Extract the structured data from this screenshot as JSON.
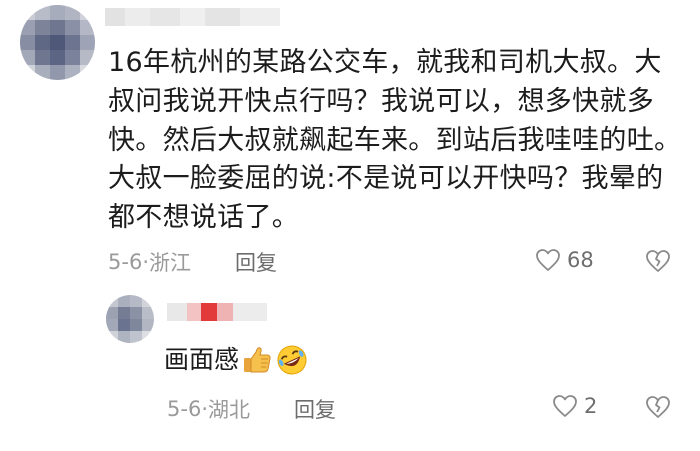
{
  "comments": [
    {
      "text": "16年杭州的某路公交车，就我和司机大叔。大叔问我说开快点行吗？我说可以，想多快就多快。然后大叔就飙起车来。到站后我哇哇的吐。大叔一脸委屈的说:不是说可以开快吗？我晕的都不想说话了。",
      "date": "5-6",
      "location": "浙江",
      "reply_label": "回复",
      "likes": "68"
    },
    {
      "text": "画面感",
      "emojis": [
        "thumbs-up",
        "rolling-laughing"
      ],
      "date": "5-6",
      "location": "湖北",
      "reply_label": "回复",
      "likes": "2"
    }
  ],
  "colors": {
    "meta": "#9a9a9a",
    "reply": "#6d6d6d",
    "text": "#1c1c1c"
  }
}
